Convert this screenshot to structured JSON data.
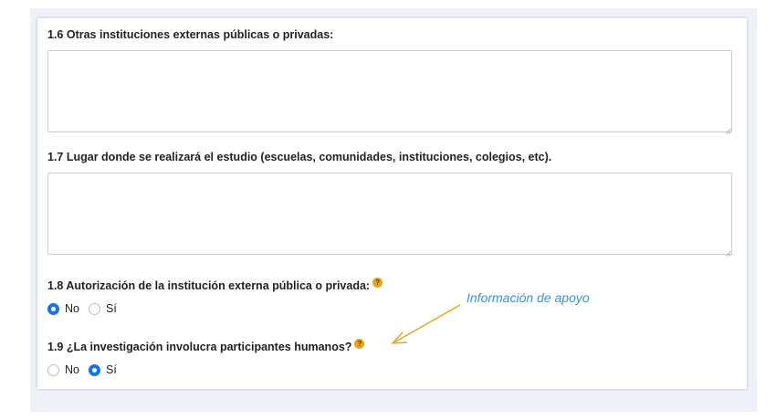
{
  "form": {
    "q16": {
      "label": "1.6 Otras instituciones externas públicas o privadas:",
      "value": ""
    },
    "q17": {
      "label": "1.7 Lugar donde se realizará el estudio (escuelas, comunidades, instituciones, colegios, etc).",
      "value": ""
    },
    "q18": {
      "label": "1.8 Autorización de la institución externa pública o privada:",
      "help_icon": "question-help-icon",
      "options": [
        {
          "label": "No",
          "selected": true
        },
        {
          "label": "Sí",
          "selected": false
        }
      ]
    },
    "q19": {
      "label": "1.9 ¿La investigación involucra participantes humanos?",
      "help_icon": "question-help-icon",
      "options": [
        {
          "label": "No",
          "selected": false
        },
        {
          "label": "Sí",
          "selected": true
        }
      ]
    }
  },
  "annotation": {
    "text": "Información de apoyo",
    "color": "#3b8fd8",
    "arrow_color": "#e3a41f"
  },
  "colors": {
    "radio_selected": "#1a73e8",
    "help_icon": "#e3a41f",
    "page_background": "#eef2f8"
  }
}
